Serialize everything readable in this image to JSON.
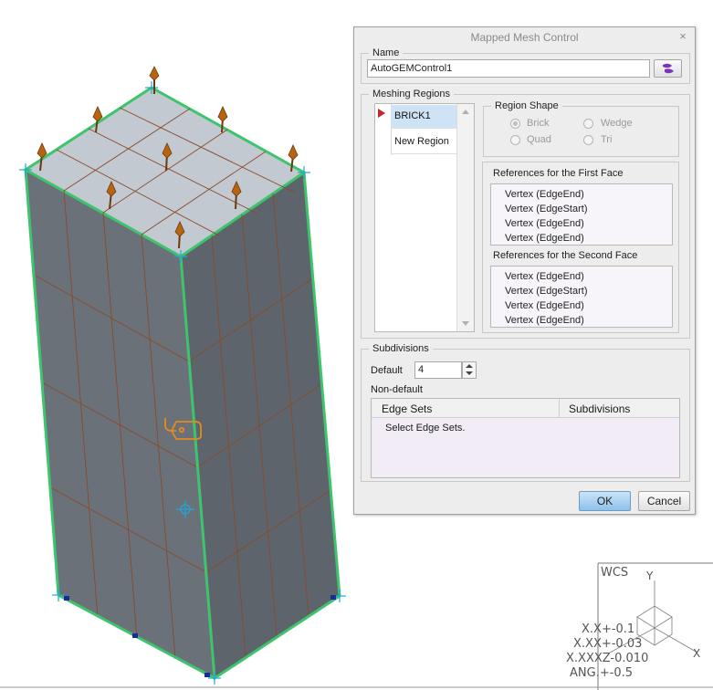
{
  "dialog": {
    "title": "Mapped Mesh Control",
    "close_label": "×",
    "name_section": {
      "legend": "Name",
      "value": "AutoGEMControl1"
    },
    "meshing_regions": {
      "legend": "Meshing Regions",
      "items": [
        {
          "label": "BRICK1",
          "selected": true
        },
        {
          "label": "New Region",
          "selected": false
        }
      ],
      "region_shape": {
        "legend": "Region Shape",
        "options": [
          {
            "label": "Brick",
            "checked": true
          },
          {
            "label": "Wedge",
            "checked": false
          },
          {
            "label": "Quad",
            "checked": false
          },
          {
            "label": "Tri",
            "checked": false
          }
        ]
      },
      "first_face": {
        "title": "References for the First Face",
        "items": [
          "Vertex (EdgeEnd)",
          "Vertex (EdgeStart)",
          "Vertex (EdgeEnd)",
          "Vertex (EdgeEnd)"
        ]
      },
      "second_face": {
        "title": "References for the Second Face",
        "items": [
          "Vertex (EdgeEnd)",
          "Vertex (EdgeStart)",
          "Vertex (EdgeEnd)",
          "Vertex (EdgeEnd)"
        ]
      }
    },
    "subdivisions": {
      "legend": "Subdivisions",
      "default_label": "Default",
      "default_value": "4",
      "non_default_label": "Non-default",
      "table": {
        "columns": [
          "Edge Sets",
          "Subdivisions"
        ],
        "placeholder": "Select Edge Sets."
      }
    },
    "ok_label": "OK",
    "cancel_label": "Cancel"
  },
  "wcs": {
    "title": "WCS",
    "axis_y": "Y",
    "axis_x": "X",
    "lines": [
      "X.X+-0.1",
      "X.XX+-0.03",
      "X.XXXZ-0.010",
      "ANG.+-0.5"
    ]
  },
  "colors": {
    "mesh_face": "#6f7680",
    "top_face": "#c3c9d1",
    "edge_highlight": "#3ec46d",
    "mesh_line": "#8a4a2a",
    "pin": "#b8630f",
    "selection_list": "#cfe3f6",
    "dialog_bg": "#ededed"
  }
}
